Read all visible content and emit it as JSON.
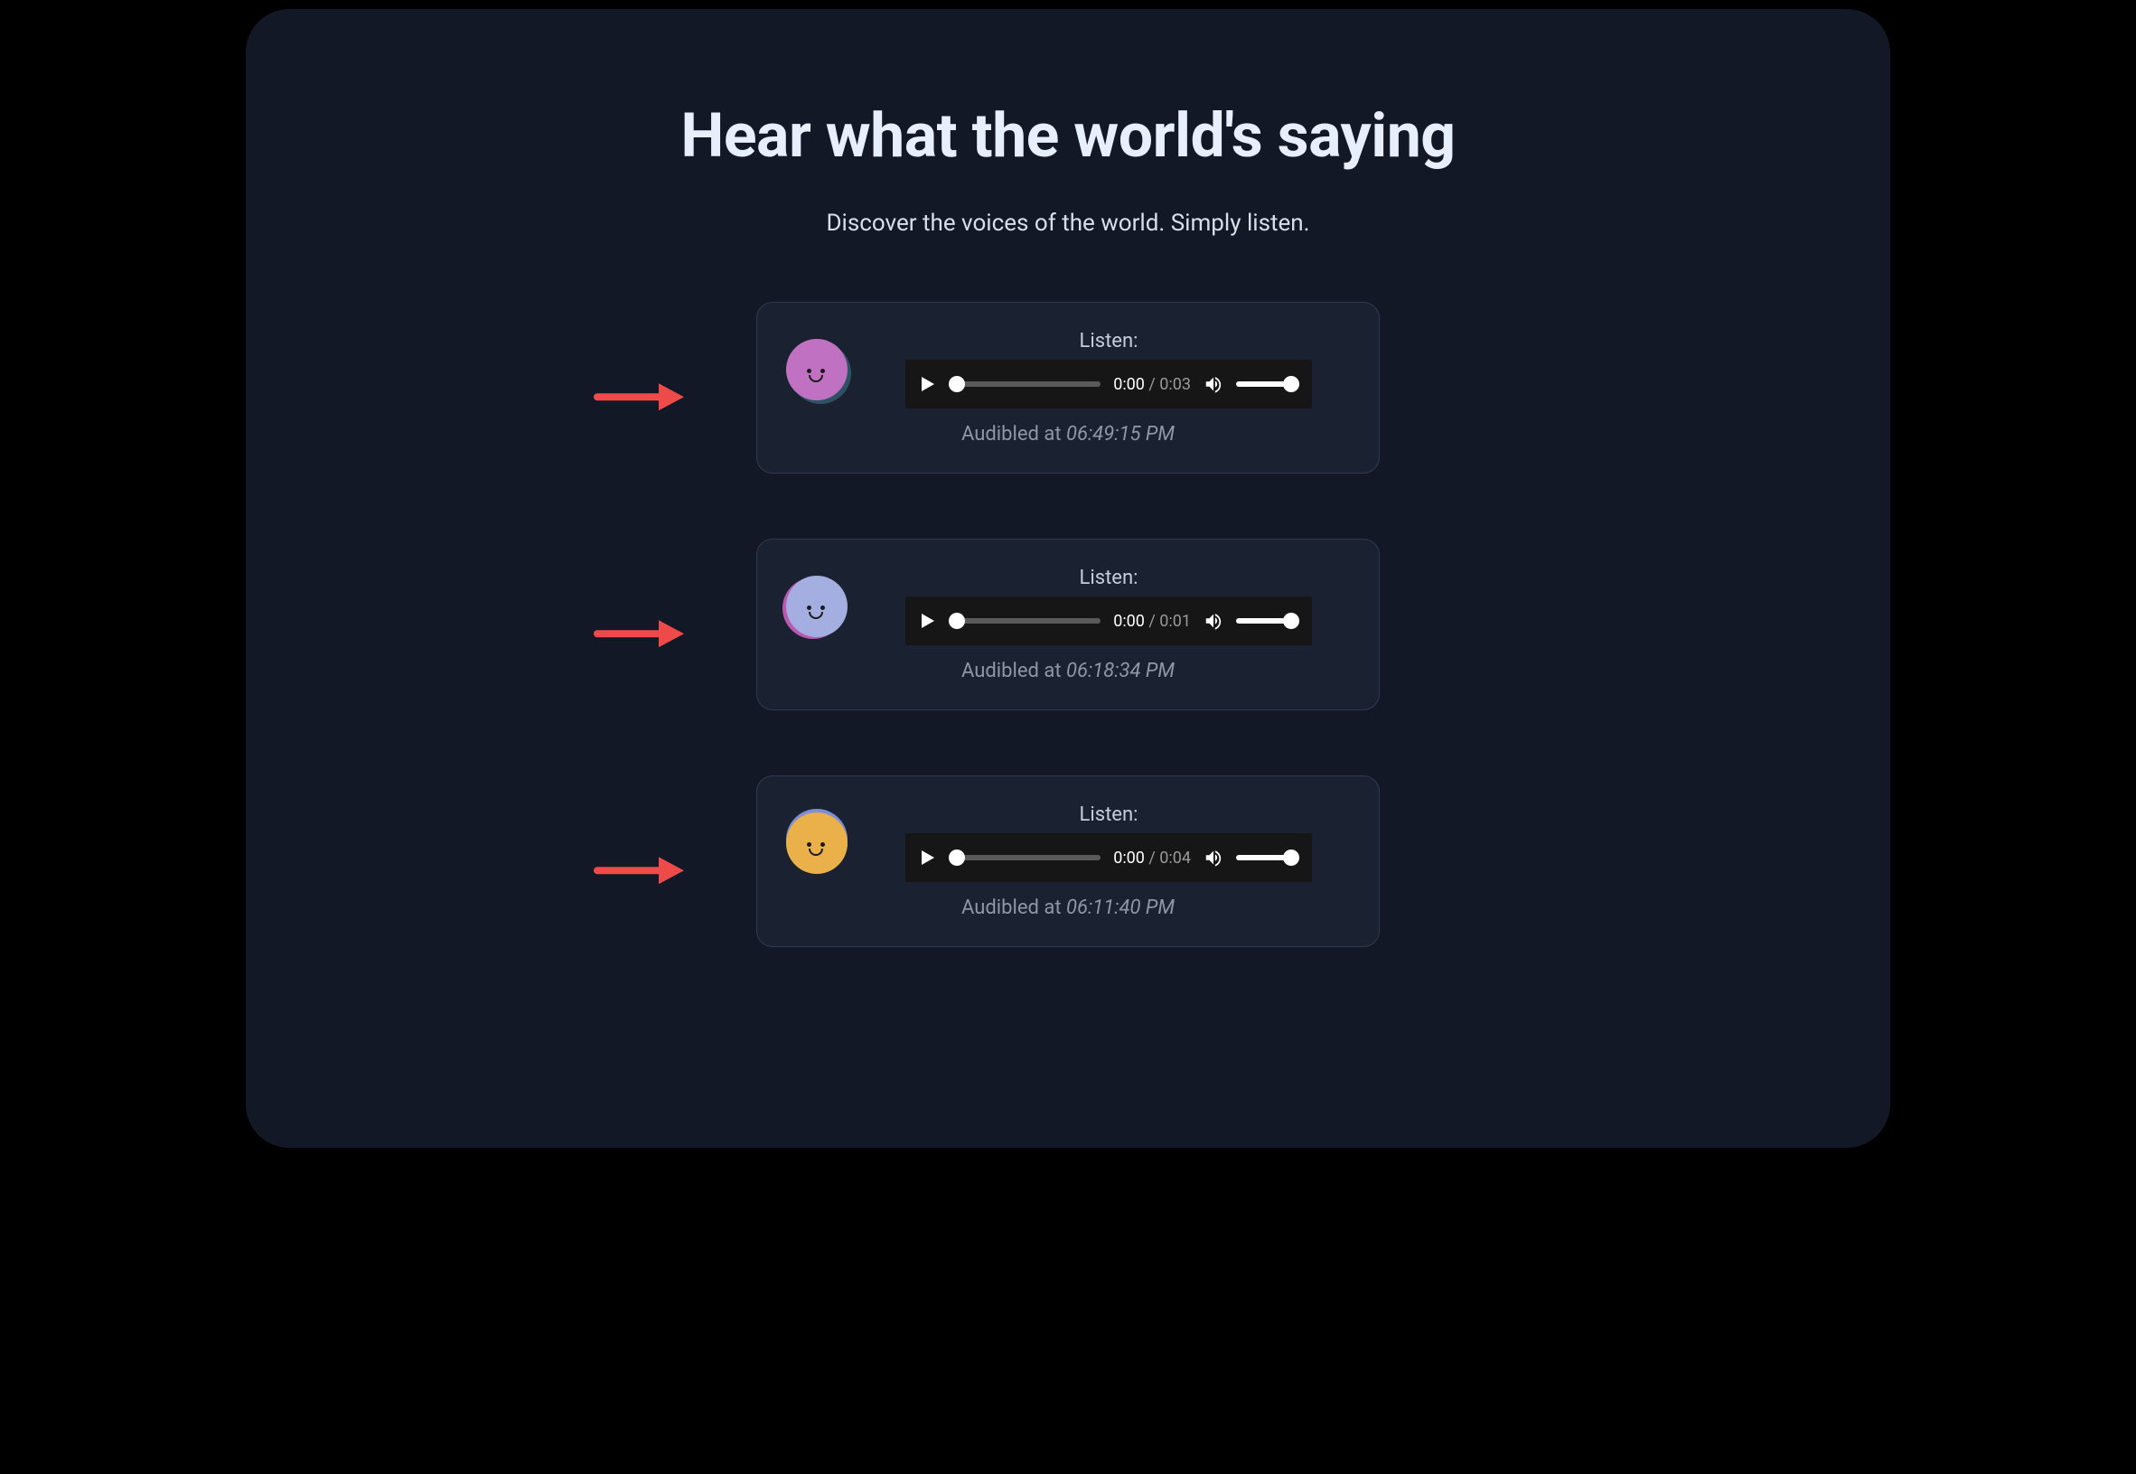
{
  "header": {
    "title": "Hear what the world's saying",
    "subtitle": "Discover the voices of the world. Simply listen."
  },
  "labels": {
    "listen": "Listen:",
    "audibled_prefix": "Audibled at ",
    "time_sep": " / "
  },
  "colors": {
    "avatar1_bg": "#c171c1",
    "avatar2_bg": "#a4aee0",
    "avatar2_ring": "#b95ab0",
    "avatar3_bg": "#eab049",
    "avatar3_ring": "#7d8dd6",
    "arrow": "#ee4a4a"
  },
  "items": [
    {
      "listen_label": "Listen:",
      "elapsed": "0:00",
      "duration": "0:03",
      "audibled_prefix": "Audibled at ",
      "timestamp": "06:49:15 PM"
    },
    {
      "listen_label": "Listen:",
      "elapsed": "0:00",
      "duration": "0:01",
      "audibled_prefix": "Audibled at ",
      "timestamp": "06:18:34 PM"
    },
    {
      "listen_label": "Listen:",
      "elapsed": "0:00",
      "duration": "0:04",
      "audibled_prefix": "Audibled at ",
      "timestamp": "06:11:40 PM"
    }
  ]
}
